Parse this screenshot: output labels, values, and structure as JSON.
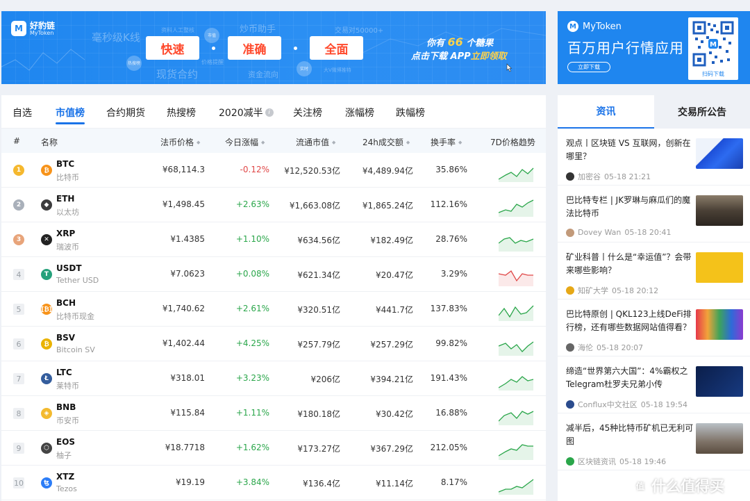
{
  "banner": {
    "brand_cn": "好豹链",
    "brand_en": "MyToken",
    "pill_1": "快速",
    "pill_2": "准确",
    "pill_3": "全面",
    "bg_text_1": "毫秒级K线",
    "bg_text_2": "资料人工整核",
    "bg_text_3": "炒币助手",
    "bg_text_4": "交易对50000+",
    "bg_text_5": "现货合约",
    "bg_text_6": "价格提醒",
    "bg_text_7": "资金流向",
    "bg_text_8": "大V微博推特",
    "bubble_1": "热搜榜",
    "bubble_2": "市值",
    "bubble_3": "实时",
    "promo_pre": "你有",
    "promo_num": "66",
    "promo_post": "个糖果",
    "promo_l2_pre": "点击下载 APP",
    "promo_l2_hl": "立即领取"
  },
  "ad": {
    "logo": "MyToken",
    "headline": "百万用户行情应用",
    "button": "立即下载",
    "qr_label": "扫码下载"
  },
  "tabs": [
    "自选",
    "市值榜",
    "合约期货",
    "热搜榜",
    "2020减半",
    "关注榜",
    "涨幅榜",
    "跌幅榜"
  ],
  "active_tab": "市值榜",
  "columns": {
    "rank": "#",
    "name": "名称",
    "price": "法币价格",
    "change": "今日涨幅",
    "cap": "流通市值",
    "volume": "24h成交额",
    "turnover": "换手率",
    "trend": "7D价格趋势"
  },
  "rows": [
    {
      "rank": "1",
      "symbol": "BTC",
      "name": "比特币",
      "price": "¥68,114.3",
      "change": "-0.12%",
      "cap": "¥12,520.53亿",
      "volume": "¥4,489.94亿",
      "turnover": "35.86%",
      "icon": "bitcoin-icon",
      "color": "#f7931a",
      "trend_up": true
    },
    {
      "rank": "2",
      "symbol": "ETH",
      "name": "以太坊",
      "price": "¥1,498.45",
      "change": "+2.63%",
      "cap": "¥1,663.08亿",
      "volume": "¥1,865.24亿",
      "turnover": "112.16%",
      "icon": "ethereum-icon",
      "color": "#3c3c3d",
      "trend_up": true
    },
    {
      "rank": "3",
      "symbol": "XRP",
      "name": "瑞波币",
      "price": "¥1.4385",
      "change": "+1.10%",
      "cap": "¥634.56亿",
      "volume": "¥182.49亿",
      "turnover": "28.76%",
      "icon": "ripple-icon",
      "color": "#222222",
      "trend_up": true
    },
    {
      "rank": "4",
      "symbol": "USDT",
      "name": "Tether USD",
      "price": "¥7.0623",
      "change": "+0.08%",
      "cap": "¥621.34亿",
      "volume": "¥20.47亿",
      "turnover": "3.29%",
      "icon": "tether-icon",
      "color": "#26a17b",
      "trend_up": false
    },
    {
      "rank": "5",
      "symbol": "BCH",
      "name": "比特币现金",
      "price": "¥1,740.62",
      "change": "+2.61%",
      "cap": "¥320.51亿",
      "volume": "¥441.7亿",
      "turnover": "137.83%",
      "icon": "bitcoin-cash-icon",
      "color": "#f7931a",
      "trend_up": true
    },
    {
      "rank": "6",
      "symbol": "BSV",
      "name": "Bitcoin SV",
      "price": "¥1,402.44",
      "change": "+4.25%",
      "cap": "¥257.79亿",
      "volume": "¥257.29亿",
      "turnover": "99.82%",
      "icon": "bitcoin-sv-icon",
      "color": "#eab300",
      "trend_up": true
    },
    {
      "rank": "7",
      "symbol": "LTC",
      "name": "莱特币",
      "price": "¥318.01",
      "change": "+3.23%",
      "cap": "¥206亿",
      "volume": "¥394.21亿",
      "turnover": "191.43%",
      "icon": "litecoin-icon",
      "color": "#345d9d",
      "trend_up": true
    },
    {
      "rank": "8",
      "symbol": "BNB",
      "name": "币安币",
      "price": "¥115.84",
      "change": "+1.11%",
      "cap": "¥180.18亿",
      "volume": "¥30.42亿",
      "turnover": "16.88%",
      "icon": "binance-icon",
      "color": "#f3ba2f",
      "trend_up": true
    },
    {
      "rank": "9",
      "symbol": "EOS",
      "name": "柚子",
      "price": "¥18.7718",
      "change": "+1.62%",
      "cap": "¥173.27亿",
      "volume": "¥367.29亿",
      "turnover": "212.05%",
      "icon": "eos-icon",
      "color": "#444444",
      "trend_up": true
    },
    {
      "rank": "10",
      "symbol": "XTZ",
      "name": "Tezos",
      "price": "¥19.19",
      "change": "+3.84%",
      "cap": "¥136.4亿",
      "volume": "¥11.14亿",
      "turnover": "8.17%",
      "icon": "tezos-icon",
      "color": "#2c7df7",
      "trend_up": true
    }
  ],
  "news_tabs": [
    "资讯",
    "交易所公告"
  ],
  "news": [
    {
      "title": "观点丨区块链 VS 互联网，创新在哪里？",
      "author": "加密谷",
      "time": "05-18 21:21",
      "thumb": "blue-cubes"
    },
    {
      "title": "巴比特专栏 | JK罗琳与麻瓜们的魔法比特币",
      "author": "Dovey Wan",
      "time": "05-18 20:41",
      "thumb": "movie-still"
    },
    {
      "title": "矿业科普丨什么是“幸运值”？会带来哪些影响？",
      "author": "知矿大学",
      "time": "05-18 20:12",
      "thumb": "yellow-card"
    },
    {
      "title": "巴比特原创 | QKL123上线DeFi排行榜，还有哪些数据网站值得看？",
      "author": "海伦",
      "time": "05-18 20:07",
      "thumb": "keyboard"
    },
    {
      "title": "缔造“世界第六大国”：4%霸权之Telegram杜罗夫兄弟小传",
      "author": "Conflux中文社区",
      "time": "05-18 19:54",
      "thumb": "dark-blue"
    },
    {
      "title": "减半后，45种比特币矿机已无利可图",
      "author": "区块链资讯",
      "time": "05-18 19:46",
      "thumb": "hourglass"
    }
  ],
  "watermark": "什么值得买",
  "colors": {
    "accent": "#1a73e8",
    "up": "#2aa64a",
    "down": "#e04848",
    "banner": "#1f86ef"
  }
}
